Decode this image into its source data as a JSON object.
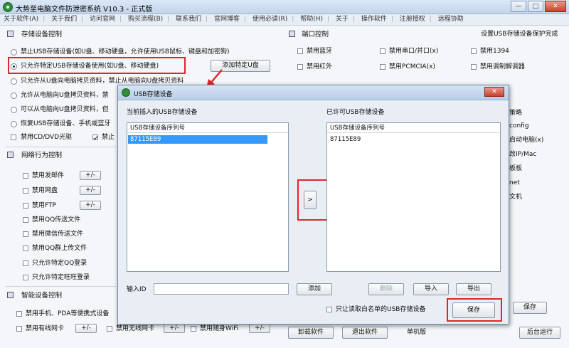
{
  "window": {
    "title": "大势至电脑文件防泄密系统 V10.3 - 正式版",
    "min_glyph": "—",
    "max_glyph": "□",
    "close_glyph": "✕"
  },
  "menu": [
    "关于软件(A)",
    "关于我们",
    "访问官网",
    "购买流程(B)",
    "联系我们",
    "官网博客",
    "使用必读(R)",
    "帮助(H)",
    "关于",
    "操作软件",
    "注册授权",
    "远程协助"
  ],
  "storage": {
    "header": "存储设备控制",
    "options": [
      "禁止USB存储设备(如U盘、移动硬盘，允许使用USB鼠标、键盘和加密狗)",
      "只允许特定USB存储设备使用(如U盘、移动硬盘)",
      "只允许从U盘向电脑拷贝资料，禁止从电脑向U盘拷贝资料",
      "允许从电脑向U盘拷贝资料，禁",
      "可以从电脑向U盘拷贝资料，但",
      "恢复USB存储设备、手机或蓝牙"
    ],
    "add_button": "添加特定U盘",
    "cd_label": "禁用CD/DVD光驱",
    "cd_label2": "禁止"
  },
  "network": {
    "header": "网络行为控制",
    "items": [
      "禁用发邮件",
      "禁用网盘",
      "禁用FTP",
      "禁用QQ传送文件",
      "禁用微信传送文件",
      "禁用QQ群上传文件",
      "只允许特定QQ登录",
      "只允许特定旺旺登录"
    ],
    "pm": "+/-"
  },
  "smart": {
    "header": "智能设备控制",
    "items": [
      "禁用手机、PDA等便携式设备",
      "禁用有线网卡",
      "禁用无线网卡",
      "禁用随身WiFi"
    ]
  },
  "port": {
    "header": "端口控制",
    "right_title": "设置USB存储设备保护完成",
    "items": [
      "禁用蓝牙",
      "禁用串口/并口(x)",
      "禁用1394",
      "禁用红外",
      "禁用PCMCIA(x)",
      "禁用调制解调器"
    ]
  },
  "right_partial": [
    "策略",
    "config",
    "启动电脑(x)",
    "改IP/Mac",
    "板板",
    "net",
    "文机"
  ],
  "bottom": {
    "save": "保存",
    "uninstall": "卸载软件",
    "exit": "退出软件",
    "standalone": "单机版",
    "background": "后台运行"
  },
  "dialog": {
    "title": "USB存储设备",
    "close": "✕",
    "left_label": "当前插入的USB存储设备",
    "right_label": "已许可USB存储设备",
    "col_header": "USB存储设备序列号",
    "left_rows": [
      "87115E89"
    ],
    "right_rows": [
      "87115E89"
    ],
    "move_button": ">",
    "input_label": "输入ID",
    "input_value": "",
    "add_button": "添加",
    "delete_button": "删除",
    "import_button": "导入",
    "export_button": "导出",
    "whitelist_label": "只让读取白名单的USB存储设备",
    "save_button": "保存"
  },
  "colors": {
    "highlight": "#e0262b",
    "selection": "#3399ff"
  }
}
